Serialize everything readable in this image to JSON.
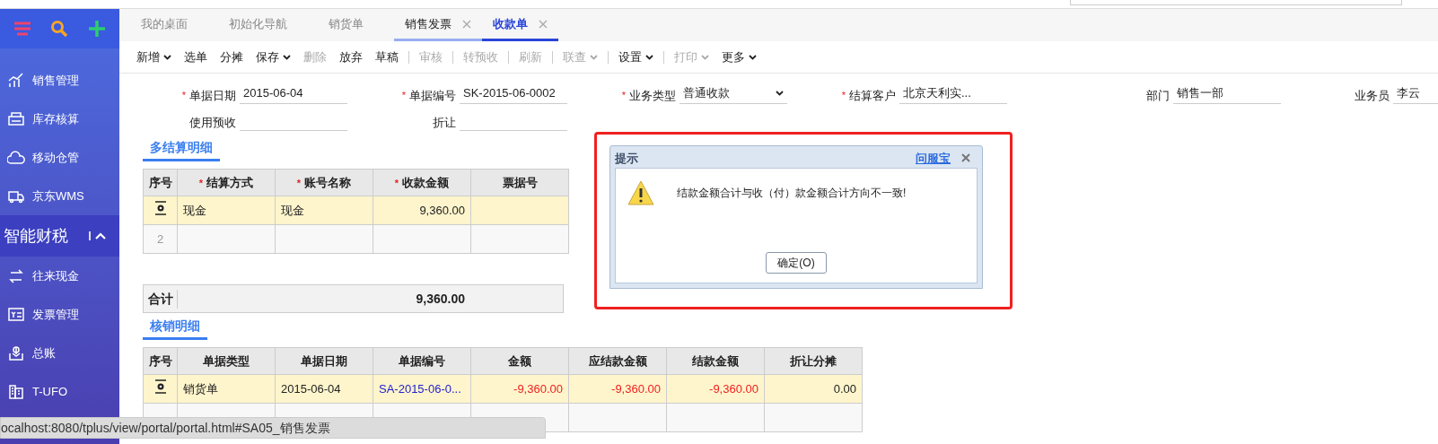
{
  "sidebar": {
    "tools": [
      {
        "kind": "menu"
      },
      {
        "kind": "search"
      },
      {
        "kind": "add"
      }
    ],
    "items": [
      {
        "label": "销售管理",
        "kind": "chart"
      },
      {
        "label": "库存核算",
        "kind": "printer"
      },
      {
        "label": "移动仓管",
        "kind": "cloud"
      },
      {
        "label": "京东WMS",
        "kind": "truck"
      }
    ],
    "section": {
      "label": "智能财税",
      "expanded": true
    },
    "section_items": [
      {
        "label": "往来现金",
        "kind": "swap"
      },
      {
        "label": "发票管理",
        "kind": "invoice"
      },
      {
        "label": "总账",
        "kind": "ledger"
      },
      {
        "label": "T-UFO",
        "kind": "building"
      }
    ]
  },
  "tabs": [
    {
      "label": "我的桌面",
      "selected": false,
      "closable": false
    },
    {
      "label": "初始化导航",
      "selected": false,
      "closable": false
    },
    {
      "label": "销货单",
      "selected": false,
      "closable": false
    },
    {
      "label": "销售发票",
      "selected": false,
      "closable": true
    },
    {
      "label": "收款单",
      "selected": true,
      "closable": true
    }
  ],
  "toolbar": [
    {
      "label": "新增",
      "disabled": false,
      "dropdown": true
    },
    {
      "label": "选单",
      "disabled": false,
      "dropdown": false
    },
    {
      "label": "分摊",
      "disabled": false,
      "dropdown": false
    },
    {
      "label": "保存",
      "disabled": false,
      "dropdown": true
    },
    {
      "label": "删除",
      "disabled": true,
      "dropdown": false
    },
    {
      "label": "放弃",
      "disabled": false,
      "dropdown": false
    },
    {
      "label": "草稿",
      "disabled": false,
      "dropdown": false
    },
    {
      "label": "审核",
      "disabled": true,
      "dropdown": false
    },
    {
      "label": "转预收",
      "disabled": true,
      "dropdown": false
    },
    {
      "label": "刷新",
      "disabled": true,
      "dropdown": false
    },
    {
      "label": "联查",
      "disabled": true,
      "dropdown": true
    },
    {
      "label": "设置",
      "disabled": false,
      "dropdown": true
    },
    {
      "label": "打印",
      "disabled": true,
      "dropdown": true
    },
    {
      "label": "更多",
      "disabled": false,
      "dropdown": true
    }
  ],
  "form": [
    [
      {
        "mark": "*",
        "label": "单据日期",
        "value": "2015-06-04",
        "kind": "text"
      },
      {
        "mark": "*",
        "label": "单据编号",
        "value": "SK-2015-06-0002",
        "kind": "text"
      },
      {
        "mark": "*",
        "label": "业务类型",
        "value": "普通收款",
        "kind": "select"
      },
      {
        "mark": "*",
        "label": "结算客户",
        "value": "北京天利实...",
        "kind": "text"
      },
      {
        "label": "部门",
        "value": "销售一部",
        "kind": "text"
      },
      {
        "label": "业务员",
        "value": "李云",
        "kind": "text"
      }
    ],
    [
      {
        "label": "使用预收",
        "kind": "text"
      },
      {
        "label": "折让",
        "kind": "text"
      }
    ]
  ],
  "settlement": {
    "title": "多结算明细",
    "columns": [
      {
        "label": "序号"
      },
      {
        "mark": "*",
        "label": "结算方式"
      },
      {
        "mark": "*",
        "label": "账号名称"
      },
      {
        "mark": "*",
        "label": "收款金额"
      },
      {
        "label": "票据号"
      }
    ],
    "rows": [
      {
        "cells": [
          "",
          "现金",
          "现金",
          "9,360.00",
          ""
        ]
      },
      {
        "cells": [
          "2",
          "",
          "",
          "",
          ""
        ]
      }
    ],
    "total_label": "合计",
    "total": "9,360.00"
  },
  "writeoff": {
    "title": "核销明细",
    "columns": [
      "序号",
      "单据类型",
      "单据日期",
      "单据编号",
      "金额",
      "应结款金额",
      "结款金额",
      "折让分摊"
    ],
    "rows": [
      {
        "cells": [
          "",
          "销货单",
          "2015-06-04",
          "SA-2015-06-0...",
          "-9,360.00",
          "-9,360.00",
          "-9,360.00",
          "0.00"
        ]
      },
      {
        "cells": [
          "",
          "",
          "",
          "",
          "",
          "",
          "",
          ""
        ]
      }
    ]
  },
  "dialog": {
    "title": "提示",
    "help_link": "问服宝",
    "message": "结款金额合计与收（付）款金额合计方向不一致!",
    "button": "确定(O)"
  },
  "status_url": "ocalhost:8080/tplus/view/portal/portal.html#SA05_销售发票"
}
